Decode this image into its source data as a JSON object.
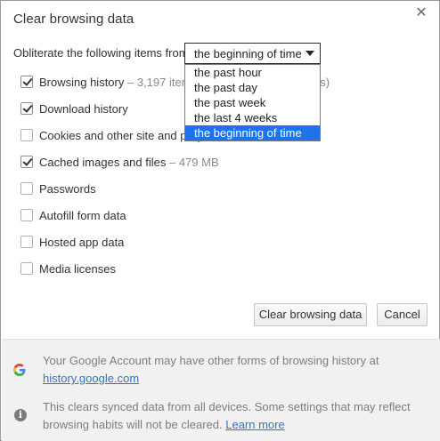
{
  "dialog": {
    "title": "Clear browsing data",
    "close_glyph": "✕"
  },
  "time_range": {
    "label": "Obliterate the following items from:",
    "selected": "the beginning of time",
    "options": [
      "the past hour",
      "the past day",
      "the past week",
      "the last 4 weeks",
      "the beginning of time"
    ]
  },
  "items": [
    {
      "label": "Browsing history",
      "meta": " – 3,197 items",
      "meta_tail": "es)",
      "checked": true
    },
    {
      "label": "Download history",
      "meta": "",
      "checked": true
    },
    {
      "label": "Cookies and other site and plug",
      "meta": "",
      "checked": false
    },
    {
      "label": "Cached images and files",
      "meta": " – 479 MB",
      "checked": true
    },
    {
      "label": "Passwords",
      "meta": "",
      "checked": false
    },
    {
      "label": "Autofill form data",
      "meta": "",
      "checked": false
    },
    {
      "label": "Hosted app data",
      "meta": "",
      "checked": false
    },
    {
      "label": "Media licenses",
      "meta": "",
      "checked": false
    }
  ],
  "buttons": {
    "clear": "Clear browsing data",
    "cancel": "Cancel"
  },
  "footer": {
    "google_text": "Your Google Account may have other forms of browsing history at",
    "google_link": "history.google.com",
    "sync_text": "This clears synced data from all devices. Some settings that may reflect browsing habits will not be cleared.",
    "learn_more": "Learn more"
  },
  "icons": {
    "google": "google-g-icon",
    "info": "info-icon",
    "close": "close-icon"
  }
}
